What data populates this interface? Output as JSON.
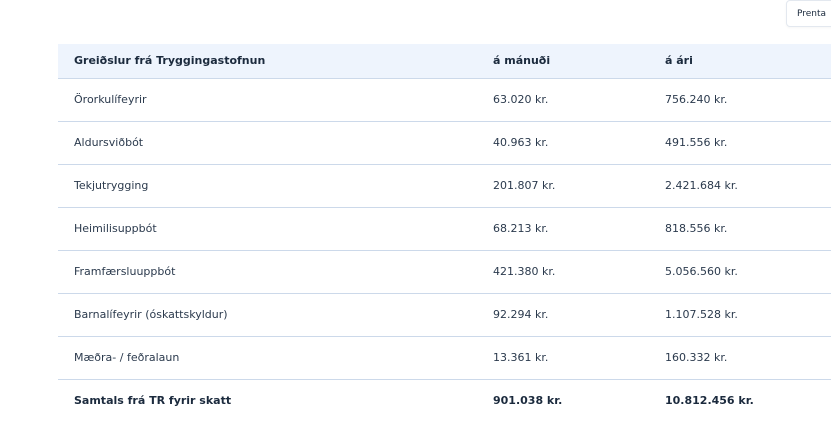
{
  "toolbar": {
    "print_label": "Prenta"
  },
  "table": {
    "headers": [
      "Greiðslur frá Tryggingastofnun",
      "á mánuði",
      "á ári"
    ],
    "rows": [
      {
        "label": "Örorkulífeyrir",
        "monthly": "63.020 kr.",
        "yearly": "756.240 kr."
      },
      {
        "label": "Aldursviðbót",
        "monthly": "40.963 kr.",
        "yearly": "491.556 kr."
      },
      {
        "label": "Tekjutrygging",
        "monthly": "201.807 kr.",
        "yearly": "2.421.684 kr."
      },
      {
        "label": "Heimilisuppbót",
        "monthly": "68.213 kr.",
        "yearly": "818.556 kr."
      },
      {
        "label": "Framfærsluuppbót",
        "monthly": "421.380 kr.",
        "yearly": "5.056.560 kr."
      },
      {
        "label": "Barnalífeyrir (óskattskyldur)",
        "monthly": "92.294 kr.",
        "yearly": "1.107.528 kr."
      },
      {
        "label": "Mæðra- / feðralaun",
        "monthly": "13.361 kr.",
        "yearly": "160.332 kr."
      }
    ],
    "total": {
      "label": "Samtals frá TR fyrir skatt",
      "monthly": "901.038 kr.",
      "yearly": "10.812.456 kr."
    }
  }
}
